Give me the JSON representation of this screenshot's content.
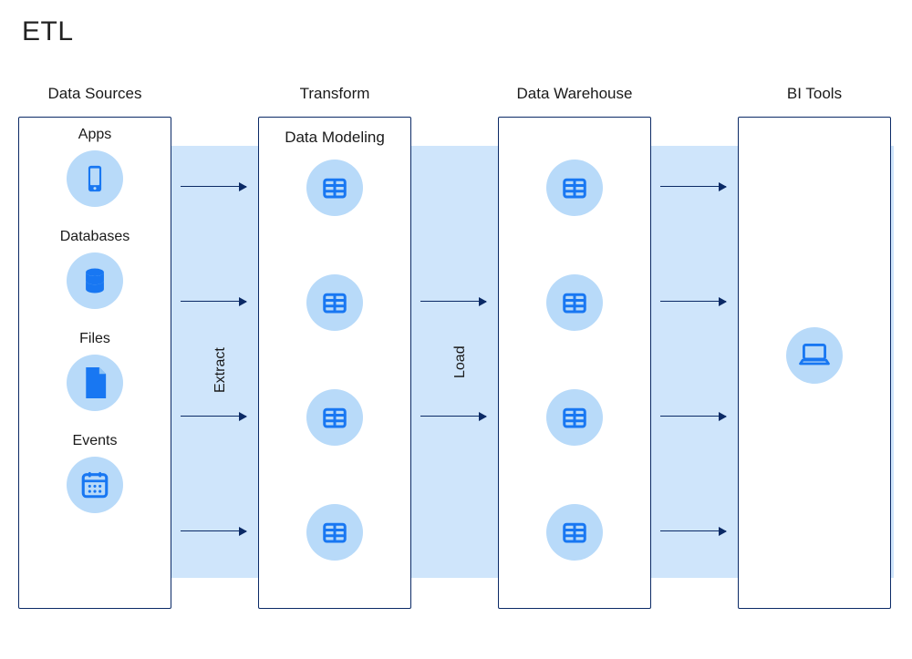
{
  "title": "ETL",
  "colors": {
    "band": "#cfe5fb",
    "icon_bg": "#b8daf9",
    "icon_fg": "#1877f2",
    "border": "#0b2a66"
  },
  "columns": {
    "sources": {
      "title": "Data Sources",
      "items": [
        {
          "label": "Apps",
          "icon": "phone-icon"
        },
        {
          "label": "Databases",
          "icon": "database-icon"
        },
        {
          "label": "Files",
          "icon": "file-icon"
        },
        {
          "label": "Events",
          "icon": "calendar-icon"
        }
      ]
    },
    "transform": {
      "title": "Transform",
      "subtitle": "Data Modeling",
      "count": 4
    },
    "warehouse": {
      "title": "Data Warehouse",
      "count": 4
    },
    "bi": {
      "title": "BI Tools",
      "icon": "laptop-icon"
    }
  },
  "stage_labels": {
    "extract": "Extract",
    "load": "Load"
  }
}
